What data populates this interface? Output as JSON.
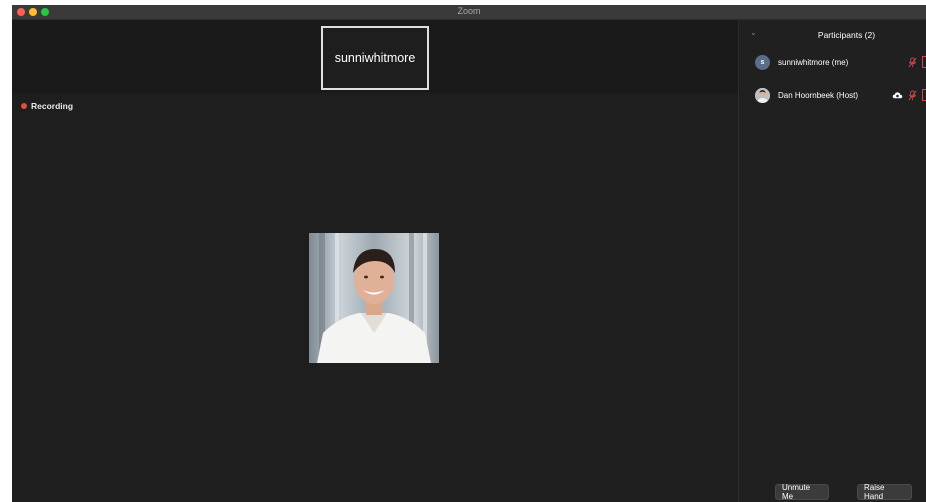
{
  "window": {
    "title": "Zoom"
  },
  "meeting": {
    "name_tile": "sunniwhitmore",
    "recording_label": "Recording"
  },
  "participants_panel": {
    "title": "Participants (2)",
    "participants": [
      {
        "name": "sunniwhitmore (me)",
        "initial": "s",
        "muted": true,
        "video_off": true
      },
      {
        "name": "Dan Hoornbeek (Host)",
        "muted": true,
        "video_off": true
      }
    ],
    "buttons": {
      "unmute": "Unmute Me",
      "raise_hand": "Raise Hand"
    }
  },
  "colors": {
    "recording": "#e74c3c",
    "muted_icon": "#d04848",
    "avatar": "#5a6d8a"
  }
}
